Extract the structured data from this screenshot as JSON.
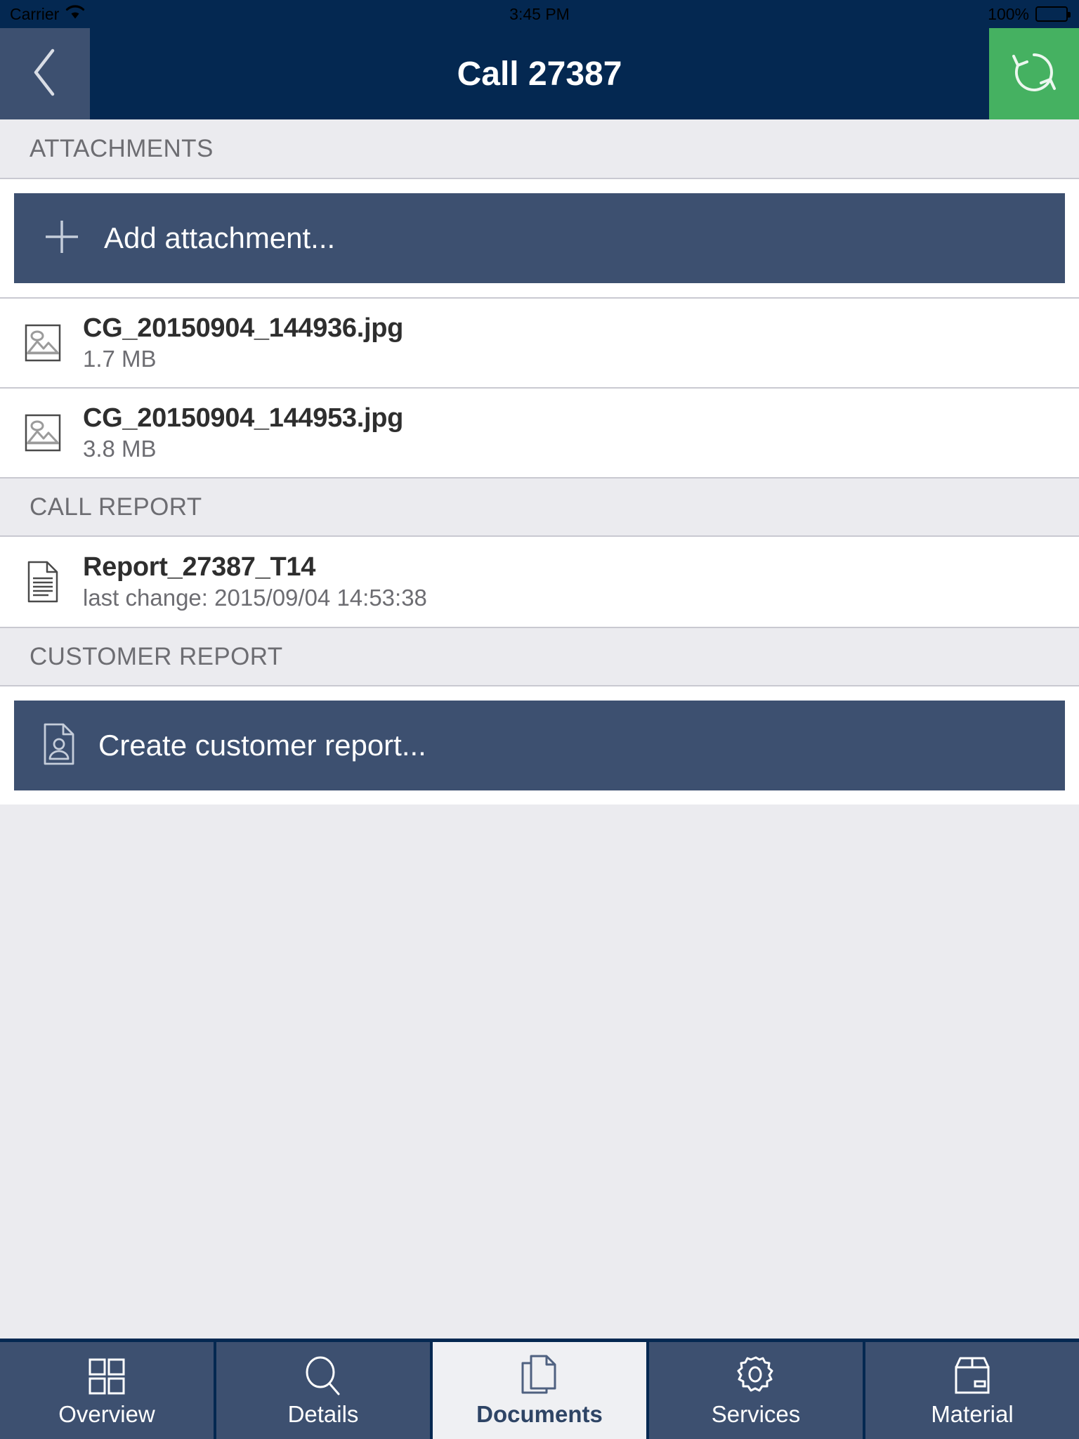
{
  "status_bar": {
    "carrier": "Carrier",
    "wifi_icon": "wifi-icon",
    "time": "3:45 PM",
    "battery_percent": "100%",
    "battery_icon": "battery-full-icon"
  },
  "nav_bar": {
    "back_icon": "chevron-left-icon",
    "title": "Call 27387",
    "refresh_icon": "refresh-icon",
    "background_color": "#042851",
    "back_button_color": "#3d5070",
    "refresh_button_color": "#45b161"
  },
  "sections": [
    {
      "header": "ATTACHMENTS",
      "action": {
        "icon": "plus-icon",
        "label": "Add attachment..."
      },
      "files": [
        {
          "icon": "image-file-icon",
          "name": "CG_20150904_144936.jpg",
          "meta": "1.7 MB"
        },
        {
          "icon": "image-file-icon",
          "name": "CG_20150904_144953.jpg",
          "meta": "3.8 MB"
        }
      ]
    },
    {
      "header": "CALL REPORT",
      "files": [
        {
          "icon": "document-file-icon",
          "name": "Report_27387_T14",
          "meta": "last change: 2015/09/04 14:53:38"
        }
      ]
    },
    {
      "header": "CUSTOMER REPORT",
      "action": {
        "icon": "person-document-icon",
        "label": "Create customer report..."
      }
    }
  ],
  "tabs": [
    {
      "icon": "grid-icon",
      "label": "Overview",
      "active": false
    },
    {
      "icon": "magnifier-icon",
      "label": "Details",
      "active": false
    },
    {
      "icon": "documents-icon",
      "label": "Documents",
      "active": true
    },
    {
      "icon": "gear-icon",
      "label": "Services",
      "active": false
    },
    {
      "icon": "box-icon",
      "label": "Material",
      "active": false
    }
  ],
  "colors": {
    "navy": "#042851",
    "slate": "#3d5070",
    "green": "#45b161",
    "page_background": "#ebebef",
    "row_background": "#ffffff",
    "separator": "#c9c9d1"
  }
}
